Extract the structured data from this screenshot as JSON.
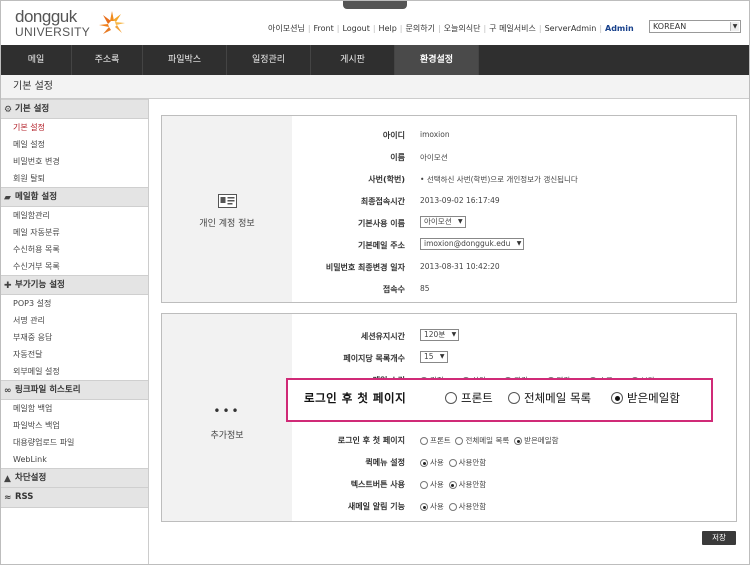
{
  "header": {
    "logo_text_1": "dongguk",
    "logo_text_2": "UNIVERSITY",
    "top_links": [
      "아이모션님",
      "Front",
      "Logout",
      "Help",
      "문의하기",
      "오늘의식단",
      "구 메일서비스",
      "ServerAdmin"
    ],
    "admin_link": "Admin",
    "language": "KOREAN"
  },
  "main_nav": [
    "메일",
    "주소록",
    "파일박스",
    "일정관리",
    "게시판",
    "환경설정"
  ],
  "breadcrumb": "기본 설정",
  "sidebar": {
    "sections": [
      {
        "title": "기본 설정",
        "icon": "gear-icon",
        "items": [
          "기본 설정",
          "메일 설정",
          "비밀번호 변경",
          "회원 탈퇴"
        ]
      },
      {
        "title": "메일함 설정",
        "icon": "folder-icon",
        "items": [
          "메일함관리",
          "메일 자동분류",
          "수신허용 목록",
          "수신거부 목록"
        ]
      },
      {
        "title": "부가기능 설정",
        "icon": "plugin-icon",
        "items": [
          "POP3 설정",
          "서명 관리",
          "부재중 응답",
          "자동전달",
          "외부메일 설정"
        ]
      },
      {
        "title": "링크파일 히스토리",
        "icon": "link-icon",
        "items": [
          "메일함 백업",
          "파일박스 백업",
          "대용량업로드 파일",
          "WebLink"
        ]
      },
      {
        "title": "차단설정",
        "icon": "block-icon",
        "items": []
      },
      {
        "title": "RSS",
        "icon": "rss-icon",
        "items": []
      }
    ],
    "selected": "기본 설정"
  },
  "account_box": {
    "title": "개인 계정 정보",
    "rows": [
      {
        "label": "아이디",
        "value": "imoxion"
      },
      {
        "label": "이름",
        "value": "아이모션"
      },
      {
        "label": "사번(학번)",
        "value": "선택하신 사번(학번)으로 개인정보가 갱신됩니다"
      },
      {
        "label": "최종접속시간",
        "value": "2013-09-02 16:17:49"
      },
      {
        "label": "기본사용 이름",
        "value": "아이모션"
      },
      {
        "label": "기본메일 주소",
        "value": "imoxion@dongguk.edu"
      },
      {
        "label": "비밀번호 최종변경 일자",
        "value": "2013-08-31 10:42:20"
      },
      {
        "label": "접속수",
        "value": "85"
      }
    ]
  },
  "extra_box": {
    "title": "추가정보",
    "session_label": "세션유지시간",
    "session_value": "120분",
    "per_page_label": "페이지당 목록개수",
    "per_page_value": "15",
    "skin_label": "메일 스킨",
    "skins": [
      {
        "name": "검정",
        "color": "#333333",
        "checked": true
      },
      {
        "name": "하얀",
        "color": "#dddddd",
        "checked": false
      },
      {
        "name": "파랑",
        "color": "#3a6fd8",
        "checked": false
      },
      {
        "name": "빨강",
        "color": "#d23a3a",
        "checked": false
      },
      {
        "name": "초록",
        "color": "#4aaa3a",
        "checked": false
      },
      {
        "name": "보라",
        "color": "#8a4ac0",
        "checked": false
      }
    ],
    "first_page_label": "로그인 후 첫 페이지",
    "first_page_options": [
      "프론트",
      "전체메일 목록",
      "받은메일함"
    ],
    "first_page_selected": 2,
    "quick_menu_label": "퀵메뉴 설정",
    "text_button_label": "텍스트버튼 사용",
    "new_mail_label": "새메일 알림 기능",
    "use": "사용",
    "no_use": "사용안함"
  },
  "popup": {
    "label": "로그인 후 첫 페이지",
    "options": [
      "프론트",
      "전체메일 목록",
      "받은메일함"
    ],
    "selected": 2
  },
  "save_button": "저장",
  "colors": {
    "nav_bg": "#2f2f2f",
    "highlight": "#d02a77",
    "selected_text": "#b3212a"
  }
}
